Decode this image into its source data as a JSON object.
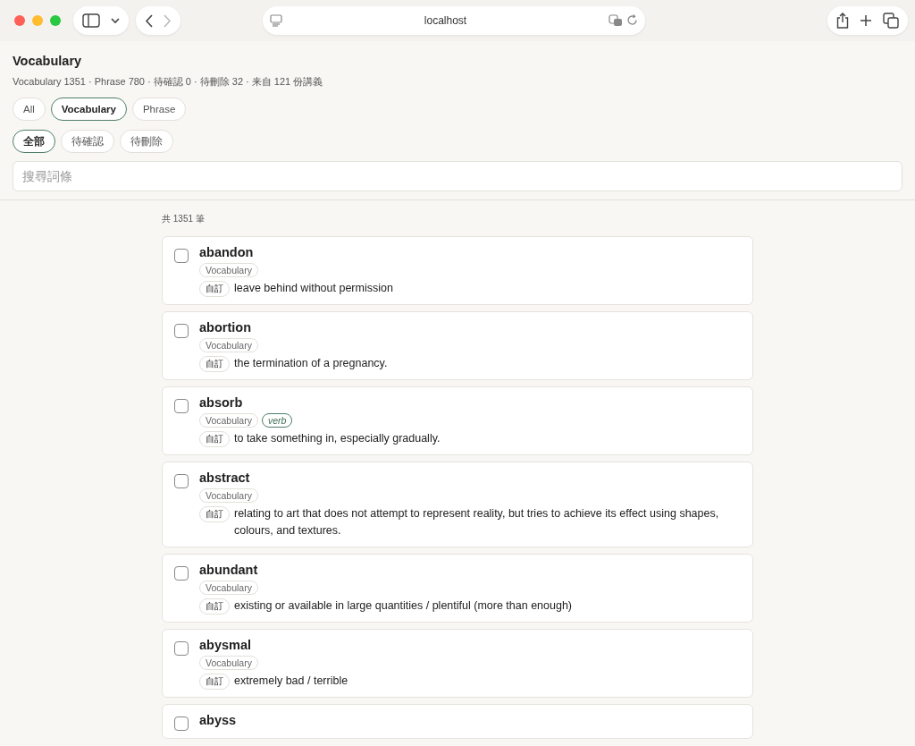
{
  "browser": {
    "address": "localhost"
  },
  "header": {
    "title": "Vocabulary",
    "summary": "Vocabulary 1351 · Phrase 780 · 待確認 0 · 待刪除 32 · 来自 121 份講義"
  },
  "type_filters": [
    {
      "label": "All",
      "selected": false
    },
    {
      "label": "Vocabulary",
      "selected": true
    },
    {
      "label": "Phrase",
      "selected": false
    }
  ],
  "status_filters": [
    {
      "label": "全部",
      "selected": true
    },
    {
      "label": "待確認",
      "selected": false
    },
    {
      "label": "待刪除",
      "selected": false
    }
  ],
  "search": {
    "placeholder": "搜尋詞條"
  },
  "count": "共 1351 筆",
  "entries": [
    {
      "word": "abandon",
      "checked": false,
      "tags": [
        {
          "label": "Vocabulary",
          "kind": "type"
        }
      ],
      "source": "自訂",
      "definition": "leave behind without permission"
    },
    {
      "word": "abortion",
      "checked": false,
      "tags": [
        {
          "label": "Vocabulary",
          "kind": "type"
        }
      ],
      "source": "自訂",
      "definition": "the termination of a pregnancy."
    },
    {
      "word": "absorb",
      "checked": false,
      "tags": [
        {
          "label": "Vocabulary",
          "kind": "type"
        },
        {
          "label": "verb",
          "kind": "pos"
        }
      ],
      "source": "自訂",
      "definition": "to take something in, especially gradually."
    },
    {
      "word": "abstract",
      "checked": false,
      "tags": [
        {
          "label": "Vocabulary",
          "kind": "type"
        }
      ],
      "source": "自訂",
      "definition": "relating to art that does not attempt to represent reality, but tries to achieve its effect using shapes, colours, and textures."
    },
    {
      "word": "abundant",
      "checked": false,
      "tags": [
        {
          "label": "Vocabulary",
          "kind": "type"
        }
      ],
      "source": "自訂",
      "definition": "existing or available in large quantities / plentiful (more than enough)"
    },
    {
      "word": "abysmal",
      "checked": false,
      "tags": [
        {
          "label": "Vocabulary",
          "kind": "type"
        }
      ],
      "source": "自訂",
      "definition": "extremely bad / terrible"
    },
    {
      "word": "abyss",
      "checked": false
    }
  ]
}
